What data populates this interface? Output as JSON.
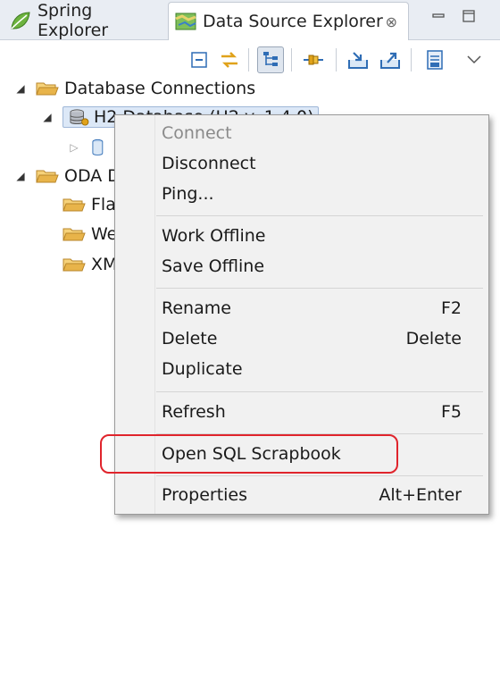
{
  "tabs": [
    {
      "label": "Spring Explorer",
      "icon": "spring-leaf-icon"
    },
    {
      "label": "Data Source Explorer",
      "icon": "data-source-map-icon",
      "close": "⊗"
    }
  ],
  "tree": {
    "database_connections": "Database Connections",
    "h2_connection": "H2 Database (H2 v. 1.4.0)",
    "oda_prefix": "ODA D",
    "folder_fla": "Fla",
    "folder_we": "We",
    "folder_xm": "XM"
  },
  "menu": {
    "connect": "Connect",
    "disconnect": "Disconnect",
    "ping": "Ping...",
    "work_offline": "Work Offline",
    "save_offline": "Save Offline",
    "rename": "Rename",
    "rename_key": "F2",
    "delete": "Delete",
    "delete_key": "Delete",
    "duplicate": "Duplicate",
    "refresh": "Refresh",
    "refresh_key": "F5",
    "open_sql_scrapbook": "Open SQL Scrapbook",
    "properties": "Properties",
    "properties_key": "Alt+Enter"
  },
  "colors": {
    "folder": "#e8b44a",
    "accent_blue": "#2f6db5",
    "highlight_red": "#e0242c"
  }
}
